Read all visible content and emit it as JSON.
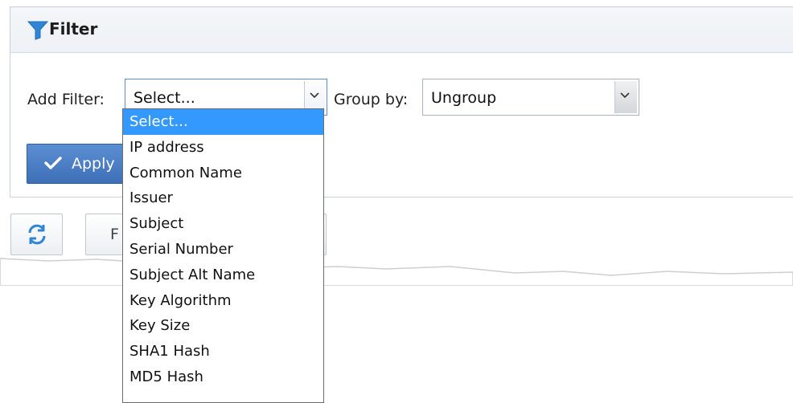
{
  "filter_panel": {
    "title": "Filter",
    "add_filter_label": "Add Filter:",
    "add_filter_value": "Select...",
    "group_by_label": "Group by:",
    "group_by_value": "Ungroup",
    "apply_label": "Apply"
  },
  "dropdown": {
    "options": [
      "Select...",
      "IP address",
      "Common Name",
      "Issuer",
      "Subject",
      "Serial Number",
      "Subject Alt Name",
      "Key Algorithm",
      "Key Size",
      "SHA1 Hash",
      "MD5 Hash"
    ],
    "selected_index": 0
  },
  "toolbar": {
    "second_button_visible_text": "F"
  },
  "colors": {
    "accent": "#3399ff",
    "apply_button": "#4a7ec4",
    "funnel_icon": "#2f86d6"
  },
  "icons": {
    "filter": "funnel-icon",
    "apply": "check-icon",
    "refresh": "refresh-icon",
    "select_arrow": "chevron-down-icon"
  }
}
